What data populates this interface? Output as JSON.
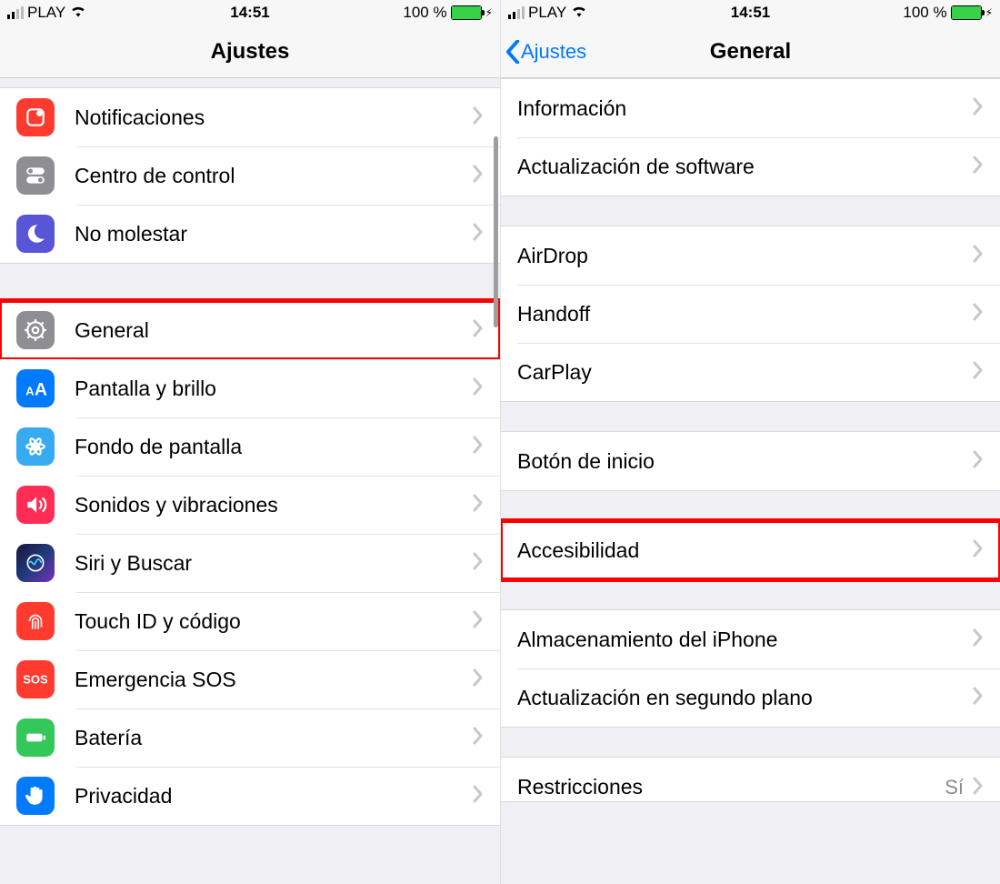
{
  "status": {
    "carrier": "PLAY",
    "time": "14:51",
    "battery_pct": "100 %"
  },
  "left": {
    "title": "Ajustes",
    "groups": [
      {
        "rows": [
          {
            "key": "notifications",
            "label": "Notificaciones",
            "icon": "bell-icon",
            "color": "red"
          },
          {
            "key": "control-center",
            "label": "Centro de control",
            "icon": "toggles-icon",
            "color": "gray"
          },
          {
            "key": "do-not-disturb",
            "label": "No molestar",
            "icon": "moon-icon",
            "color": "purple"
          }
        ]
      },
      {
        "rows": [
          {
            "key": "general",
            "label": "General",
            "icon": "gear-icon",
            "color": "gray",
            "highlight": true
          },
          {
            "key": "display",
            "label": "Pantalla y brillo",
            "icon": "text-size-icon",
            "color": "blue"
          },
          {
            "key": "wallpaper",
            "label": "Fondo de pantalla",
            "icon": "flower-icon",
            "color": "teal"
          },
          {
            "key": "sounds",
            "label": "Sonidos y vibraciones",
            "icon": "speaker-icon",
            "color": "pink"
          },
          {
            "key": "siri",
            "label": "Siri y Buscar",
            "icon": "siri-icon",
            "color": "siri"
          },
          {
            "key": "touchid",
            "label": "Touch ID y código",
            "icon": "fingerprint-icon",
            "color": "red"
          },
          {
            "key": "sos",
            "label": "Emergencia SOS",
            "icon": "sos-icon",
            "color": "red"
          },
          {
            "key": "battery",
            "label": "Batería",
            "icon": "battery-icon",
            "color": "green"
          },
          {
            "key": "privacy",
            "label": "Privacidad",
            "icon": "hand-icon",
            "color": "blue"
          }
        ]
      }
    ]
  },
  "right": {
    "back": "Ajustes",
    "title": "General",
    "groups": [
      {
        "rows": [
          {
            "key": "about",
            "label": "Información"
          },
          {
            "key": "software-update",
            "label": "Actualización de software"
          }
        ]
      },
      {
        "rows": [
          {
            "key": "airdrop",
            "label": "AirDrop"
          },
          {
            "key": "handoff",
            "label": "Handoff"
          },
          {
            "key": "carplay",
            "label": "CarPlay"
          }
        ]
      },
      {
        "rows": [
          {
            "key": "home-button",
            "label": "Botón de inicio"
          }
        ]
      },
      {
        "rows": [
          {
            "key": "accessibility",
            "label": "Accesibilidad",
            "highlight": true
          }
        ]
      },
      {
        "rows": [
          {
            "key": "storage",
            "label": "Almacenamiento del iPhone"
          },
          {
            "key": "background-refresh",
            "label": "Actualización en segundo plano"
          }
        ]
      },
      {
        "rows": [
          {
            "key": "restrictions",
            "label": "Restricciones",
            "value": "Sí",
            "partial": true
          }
        ]
      }
    ]
  }
}
